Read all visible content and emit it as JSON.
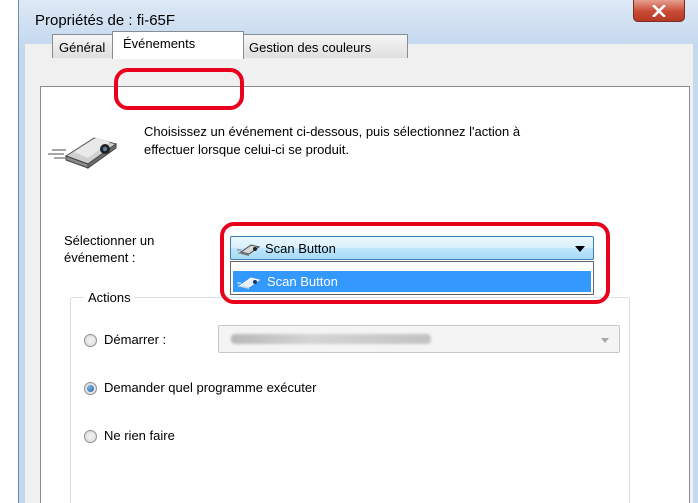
{
  "window": {
    "title": "Propriétés de : fi-65F"
  },
  "tabs": [
    {
      "label": "Général",
      "active": false
    },
    {
      "label": "Événements",
      "active": true
    },
    {
      "label": "Gestion des couleurs",
      "active": false
    }
  ],
  "description": {
    "line1": "Choisissez un événement ci-dessous, puis sélectionnez l'action à",
    "line2": "effectuer lorsque celui-ci se produit."
  },
  "event_select": {
    "label_line1": "Sélectionner un",
    "label_line2": "événement :",
    "value": "Scan Button",
    "options": [
      "Scan Button"
    ]
  },
  "actions": {
    "legend": "Actions",
    "start_label": "Démarrer :",
    "prompt_label": "Demander quel programme exécuter",
    "nothing_label": "Ne rien faire",
    "selected": "prompt"
  },
  "colors": {
    "highlight": "#e8001c",
    "selection": "#3399ff"
  }
}
